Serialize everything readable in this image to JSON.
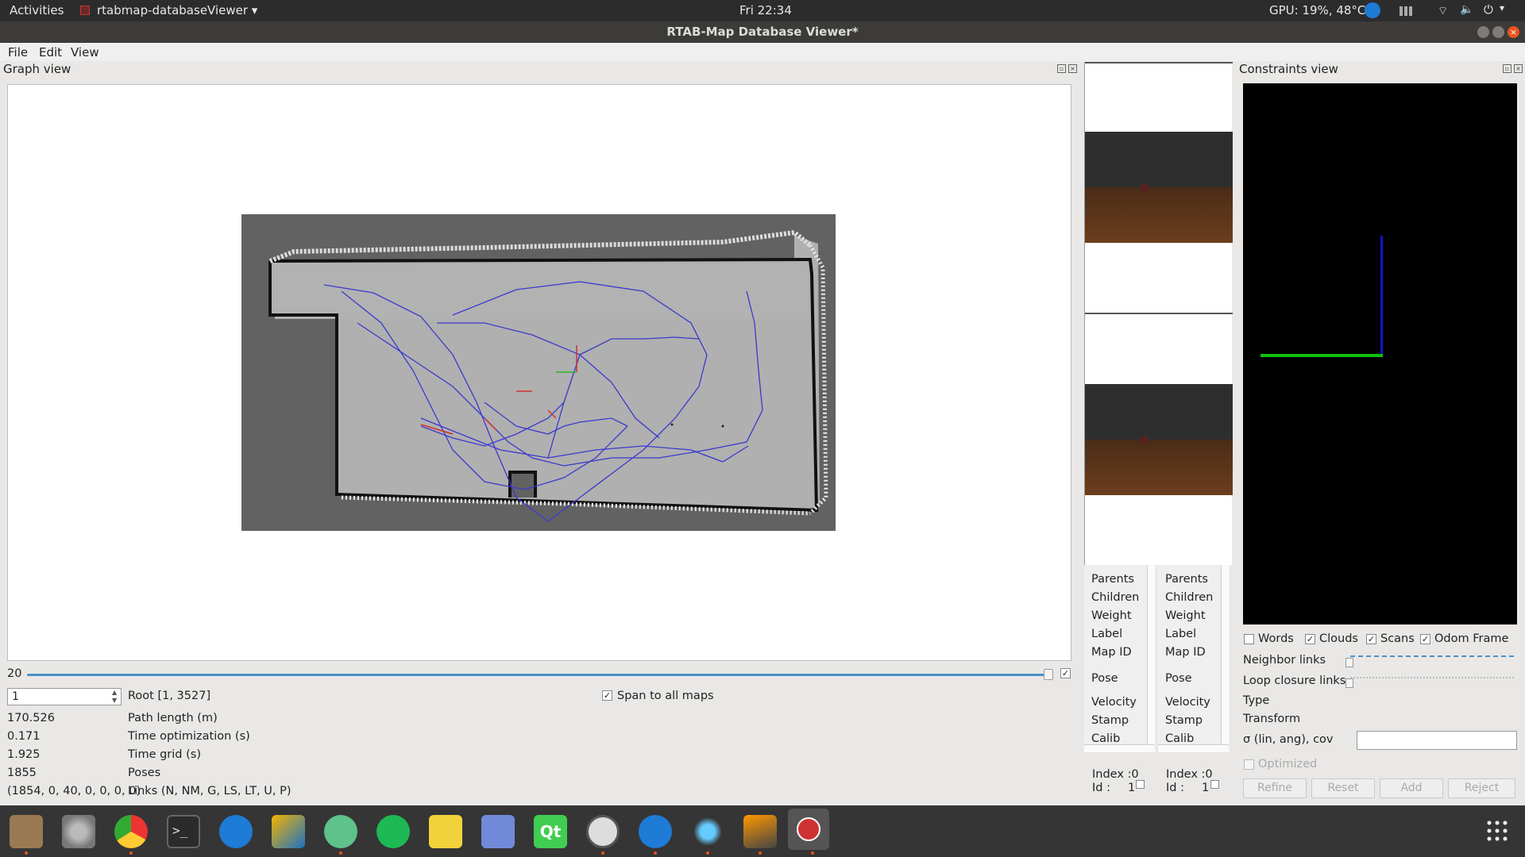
{
  "topbar": {
    "activities": "Activities",
    "app_name": "rtabmap-databaseViewer ▾",
    "clock": "Fri 22:34",
    "gpu": "GPU: 19%, 48°C"
  },
  "window": {
    "title": "RTAB-Map Database Viewer*"
  },
  "menu": {
    "file": "File",
    "edit": "Edit",
    "view": "View"
  },
  "graph_view": {
    "title": "Graph view",
    "slider_value": "20",
    "root_spin_value": "1",
    "root_label": "Root [1, 3527]",
    "span_label": "Span to all maps",
    "stats": [
      {
        "value": "170.526",
        "label": "Path length (m)"
      },
      {
        "value": "0.171",
        "label": "Time optimization (s)"
      },
      {
        "value": "1.925",
        "label": "Time grid (s)"
      },
      {
        "value": "1855",
        "label": "Poses"
      },
      {
        "value": "(1854, 0, 40, 0, 0, 0, 0)",
        "label": "Links (N, NM, G, LS, LT, U, P)"
      }
    ]
  },
  "node_info_left": {
    "labels": [
      "Parents",
      "Children",
      "Weight",
      "Label",
      "Map ID",
      "Pose",
      "Velocity",
      "Stamp",
      "Calib"
    ],
    "index": "Index :0",
    "id_label": "Id :",
    "id_value": "1"
  },
  "node_info_right": {
    "labels": [
      "Parents",
      "Children",
      "Weight",
      "Label",
      "Map ID",
      "Pose",
      "Velocity",
      "Stamp",
      "Calib"
    ],
    "index": "Index :0",
    "id_label": "Id :",
    "id_value": "1"
  },
  "constraints_view": {
    "title": "Constraints view",
    "checks": [
      {
        "label": "Words",
        "checked": ""
      },
      {
        "label": "Clouds",
        "checked": "✓"
      },
      {
        "label": "Scans",
        "checked": "✓"
      },
      {
        "label": "Odom Frame",
        "checked": "✓"
      }
    ],
    "neighbor_links": "Neighbor links",
    "loop_closure_links": "Loop closure links",
    "type": "Type",
    "transform": "Transform",
    "sigma": "σ (lin, ang), cov",
    "optimized": "Optimized",
    "buttons": {
      "refine": "Refine",
      "reset": "Reset",
      "add": "Add",
      "reject": "Reject"
    }
  },
  "taskbar_icons": [
    "files-icon",
    "settings-icon",
    "chrome-icon",
    "terminal-icon",
    "teamviewer-icon",
    "virtualbox-icon",
    "atom-icon",
    "spotify-icon",
    "notes-icon",
    "discord-icon",
    "qt-icon",
    "software-updater-icon",
    "teamviewer2-icon",
    "splash-icon",
    "sublime-icon",
    "rtabmap-icon"
  ]
}
